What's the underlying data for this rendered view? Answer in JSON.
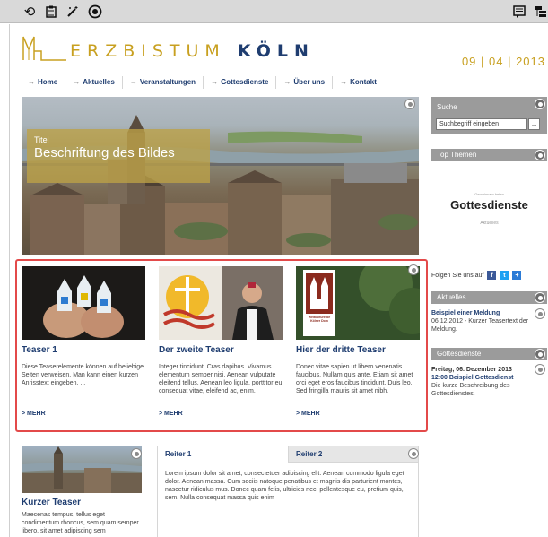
{
  "toolbar": {
    "left_icons": [
      "history-icon",
      "clipboard-icon",
      "magic-wand-icon",
      "record-icon"
    ],
    "right_icons": [
      "comment-icon",
      "sitemap-icon"
    ]
  },
  "header": {
    "logo_light": "ERZBISTUM",
    "logo_bold": "KÖLN",
    "date": "09 | 04 | 2013"
  },
  "nav": {
    "items": [
      "Home",
      "Aktuelles",
      "Veranstaltungen",
      "Gottesdienste",
      "Über uns",
      "Kontakt"
    ]
  },
  "hero": {
    "caption_small": "Titel",
    "caption_large": "Beschriftung des Bildes"
  },
  "teasers": [
    {
      "title": "Teaser 1",
      "text": "Diese Teaserelemente können auf beliebige Seiten verweisen. Man kann einen kurzen Anrisstext eingeben. ...",
      "more": "> MEHR"
    },
    {
      "title": "Der zweite Teaser",
      "text": "Integer tincidunt. Cras dapibus. Vivamus elementum semper nisi. Aenean vulputate eleifend tellus. Aenean leo ligula, porttitor eu, consequat vitae, eleifend ac, enim.",
      "more": "> MEHR"
    },
    {
      "title": "Hier der dritte Teaser",
      "text": "Donec vitae sapien ut libero venenatis faucibus. Nullam quis ante. Etiam sit amet orci eget eros faucibus tincidunt. Duis leo. Sed fringilla mauris sit amet nibh.",
      "more": "> MEHR",
      "sign_text": "Weltkulturerbe Kölner Dom"
    }
  ],
  "kurzer": {
    "title": "Kurzer Teaser",
    "text": "Maecenas tempus, tellus eget condimentum rhoncus, sem quam semper libero, sit amet adipiscing sem"
  },
  "tabs": {
    "tab1": "Reiter 1",
    "tab2": "Reiter 2",
    "content": "Lorem ipsum dolor sit amet, consectetuer adipiscing elit. Aenean commodo ligula eget dolor. Aenean massa. Cum sociis natoque penatibus et magnis dis parturient montes, nascetur ridiculus mus. Donec quam felis, ultricies nec, pellentesque eu, pretium quis, sem. Nulla consequat massa quis enim"
  },
  "sidebar": {
    "search_head": "Suche",
    "search_value": "Suchbegriff eingeben",
    "search_btn": "→",
    "themen_head": "Top Themen",
    "logo_small": "Gemeinsam beten",
    "logo_big": "Gottesdienste",
    "logo_sub": "Aktuelles",
    "follow_label": "Folgen Sie uns auf",
    "aktuelles_head": "Aktuelles",
    "news_title": "Beispiel einer Meldung",
    "news_text": "06.12.2012 - Kurzer Teasertext der Meldung.",
    "gd_head": "Gottesdienste",
    "gd_date": "Freitag, 06. Dezember 2013",
    "gd_title": "12:00 Beispiel Gottesdienst",
    "gd_text": "Die kurze Beschreibung des Gottesdienstes."
  }
}
